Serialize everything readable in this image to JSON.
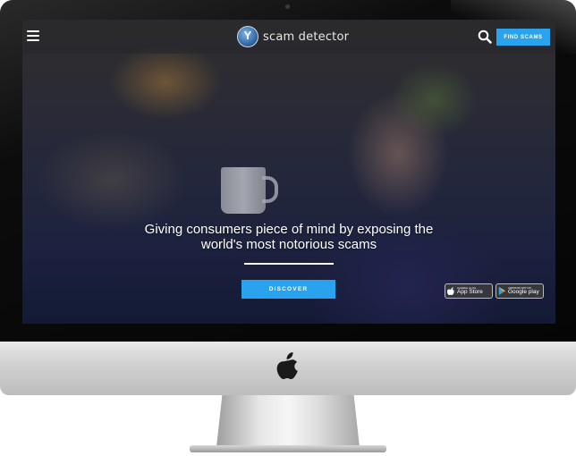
{
  "header": {
    "logo_text": "scam detector",
    "find_scams_label": "FIND SCAMS"
  },
  "hero": {
    "headline": "Giving consumers piece of mind by exposing the world's most notorious scams",
    "discover_label": "DISCOVER"
  },
  "badges": {
    "app_store_small": "Available on the",
    "app_store_big": "App Store",
    "google_play_small": "ANDROID APP ON",
    "google_play_big": "Google play"
  },
  "colors": {
    "accent": "#2aa3ef",
    "topbar": "#28282c",
    "bezel": "#0c0c0c"
  },
  "icons": [
    "menu-icon",
    "search-icon",
    "apple-icon",
    "app-store-icon",
    "google-play-icon"
  ]
}
